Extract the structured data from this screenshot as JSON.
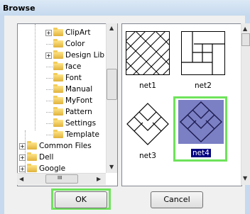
{
  "window": {
    "title": "Browse"
  },
  "tree": {
    "items": [
      {
        "label": "ClipArt",
        "expandable": true
      },
      {
        "label": "Color",
        "expandable": false
      },
      {
        "label": "Design Lib",
        "expandable": true
      },
      {
        "label": "face",
        "expandable": false
      },
      {
        "label": "Font",
        "expandable": false
      },
      {
        "label": "Manual",
        "expandable": false
      },
      {
        "label": "MyFont",
        "expandable": false
      },
      {
        "label": "Pattern",
        "expandable": false
      },
      {
        "label": "Settings",
        "expandable": false
      },
      {
        "label": "Template",
        "expandable": false
      },
      {
        "label": "Common Files",
        "expandable": true
      },
      {
        "label": "Dell",
        "expandable": true
      },
      {
        "label": "Google",
        "expandable": true
      }
    ],
    "hscroll_grip": "III"
  },
  "patterns": {
    "items": [
      {
        "label": "net1",
        "selected": false
      },
      {
        "label": "net2",
        "selected": false
      },
      {
        "label": "net3",
        "selected": false
      },
      {
        "label": "net4",
        "selected": true
      }
    ],
    "selected_fill": "#7b7fc4"
  },
  "buttons": {
    "ok": "OK",
    "cancel": "Cancel"
  },
  "colors": {
    "highlight": "#6ee35b",
    "selection": "#000080"
  }
}
